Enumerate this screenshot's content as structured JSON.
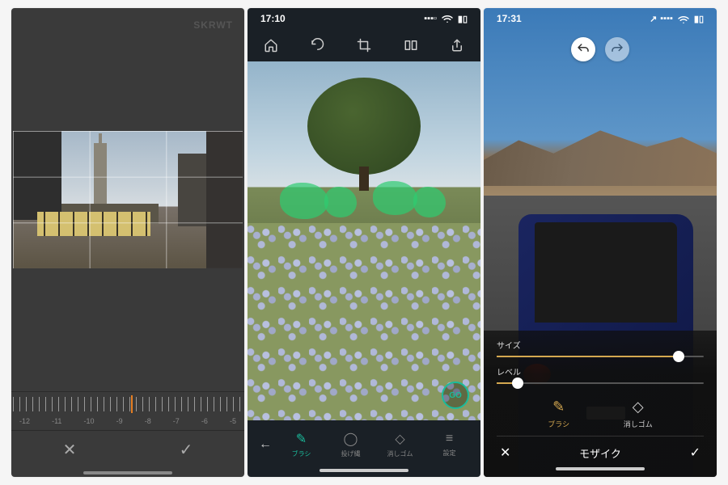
{
  "phone1": {
    "watermark": "SKRWT",
    "ruler_labels": [
      "-12",
      "-11",
      "-10",
      "-9",
      "-8",
      "-7",
      "-6",
      "-5"
    ],
    "cancel_icon": "✕",
    "confirm_icon": "✓"
  },
  "phone2": {
    "status": {
      "time": "17:10",
      "signal": "▪▪▪▫",
      "wifi": "✓",
      "battery": "▮▯"
    },
    "top_icons": [
      "home",
      "undo",
      "crop",
      "compare",
      "share"
    ],
    "go_label": "GO",
    "back_icon": "←",
    "tools": [
      {
        "name": "brush",
        "label": "ブラシ",
        "icon": "✎",
        "active": true
      },
      {
        "name": "lasso",
        "label": "投げ縄",
        "icon": "◯",
        "active": false
      },
      {
        "name": "eraser",
        "label": "消しゴム",
        "icon": "◇",
        "active": false
      },
      {
        "name": "settings",
        "label": "設定",
        "icon": "≡",
        "active": false
      }
    ]
  },
  "phone3": {
    "status": {
      "time": "17:31",
      "loc": "↗",
      "signal": "▪▪▪▪",
      "wifi": "✓",
      "battery": "▮▯"
    },
    "sliders": [
      {
        "name": "size",
        "label": "サイズ",
        "value": 88
      },
      {
        "name": "level",
        "label": "レベル",
        "value": 10
      }
    ],
    "tools": [
      {
        "name": "brush",
        "label": "ブラシ",
        "icon": "✎",
        "active": true
      },
      {
        "name": "eraser",
        "label": "消しゴム",
        "icon": "◇",
        "active": false
      }
    ],
    "title": "モザイク",
    "cancel_icon": "✕",
    "confirm_icon": "✓"
  }
}
